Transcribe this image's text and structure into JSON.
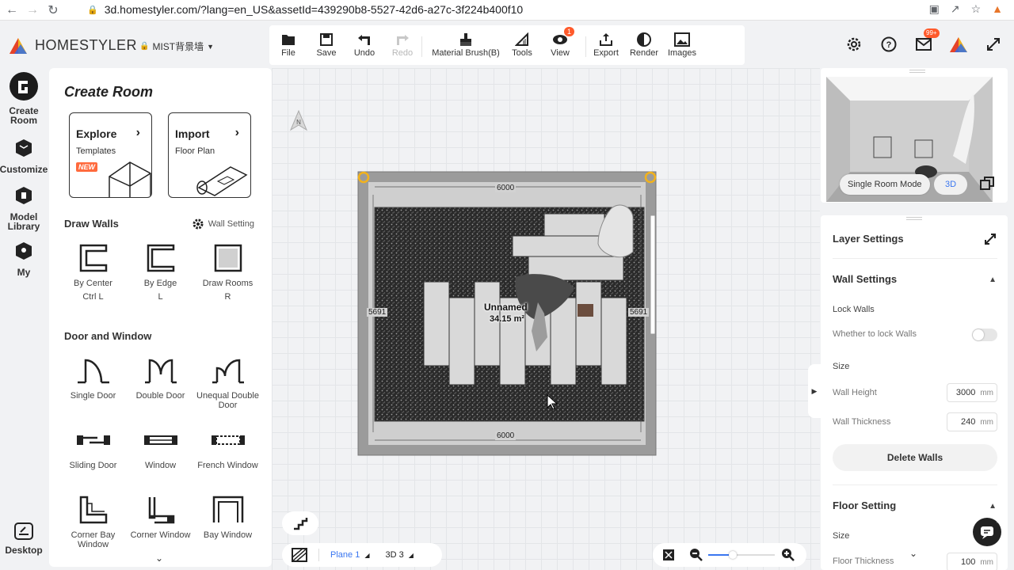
{
  "browser": {
    "url": "3d.homestyler.com/?lang=en_US&assetId=439290b8-5527-42d6-a27c-3f224b400f10"
  },
  "app": {
    "brand": "HOMESTYLER",
    "project_name": "MIST背景墙"
  },
  "toolbar": {
    "file": "File",
    "save": "Save",
    "undo": "Undo",
    "redo": "Redo",
    "material_brush": "Material Brush(B)",
    "tools": "Tools",
    "view": "View",
    "view_badge": "1",
    "export": "Export",
    "render": "Render",
    "images": "Images"
  },
  "header_icons": {
    "mail_badge": "99+"
  },
  "rail": {
    "create_room": "Create Room",
    "customize": "Customize",
    "model_library": "Model Library",
    "my": "My",
    "desktop": "Desktop"
  },
  "panel": {
    "title": "Create Room",
    "explore": {
      "title": "Explore",
      "subtitle": "Templates",
      "badge": "NEW"
    },
    "import": {
      "title": "Import",
      "subtitle": "Floor Plan"
    },
    "draw_walls": {
      "heading": "Draw Walls",
      "setting": "Wall Setting",
      "items": [
        {
          "label": "By Center",
          "shortcut": "Ctrl L"
        },
        {
          "label": "By Edge",
          "shortcut": "L"
        },
        {
          "label": "Draw Rooms",
          "shortcut": "R"
        }
      ]
    },
    "door_window": {
      "heading": "Door and Window",
      "items": [
        {
          "label": "Single Door"
        },
        {
          "label": "Double Door"
        },
        {
          "label": "Unequal Double Door"
        },
        {
          "label": "Sliding Door"
        },
        {
          "label": "Window"
        },
        {
          "label": "French Window"
        },
        {
          "label": "Corner Bay Window"
        },
        {
          "label": "Corner Window"
        },
        {
          "label": "Bay Window"
        }
      ]
    }
  },
  "canvas": {
    "room_name": "Unnamed",
    "room_area": "34.15 m²",
    "dim_top": "6000",
    "dim_bottom": "6000",
    "dim_left": "5691",
    "dim_right": "5691",
    "compass_label": "N"
  },
  "bottom": {
    "plane": "Plane 1",
    "view3d": "3D 3"
  },
  "preview": {
    "single_room_mode": "Single Room Mode",
    "mode_3d": "3D"
  },
  "settings": {
    "layer_settings": "Layer Settings",
    "wall_settings": "Wall Settings",
    "lock_walls": "Lock Walls",
    "lock_walls_desc": "Whether to lock Walls",
    "size": "Size",
    "wall_height_label": "Wall Height",
    "wall_height": "3000",
    "wall_thickness_label": "Wall Thickness",
    "wall_thickness": "240",
    "unit": "mm",
    "delete_walls": "Delete Walls",
    "floor_setting": "Floor Setting",
    "floor_size": "Size",
    "floor_thickness_label": "Floor Thickness",
    "floor_thickness": "100",
    "lock_walls_on": false
  }
}
